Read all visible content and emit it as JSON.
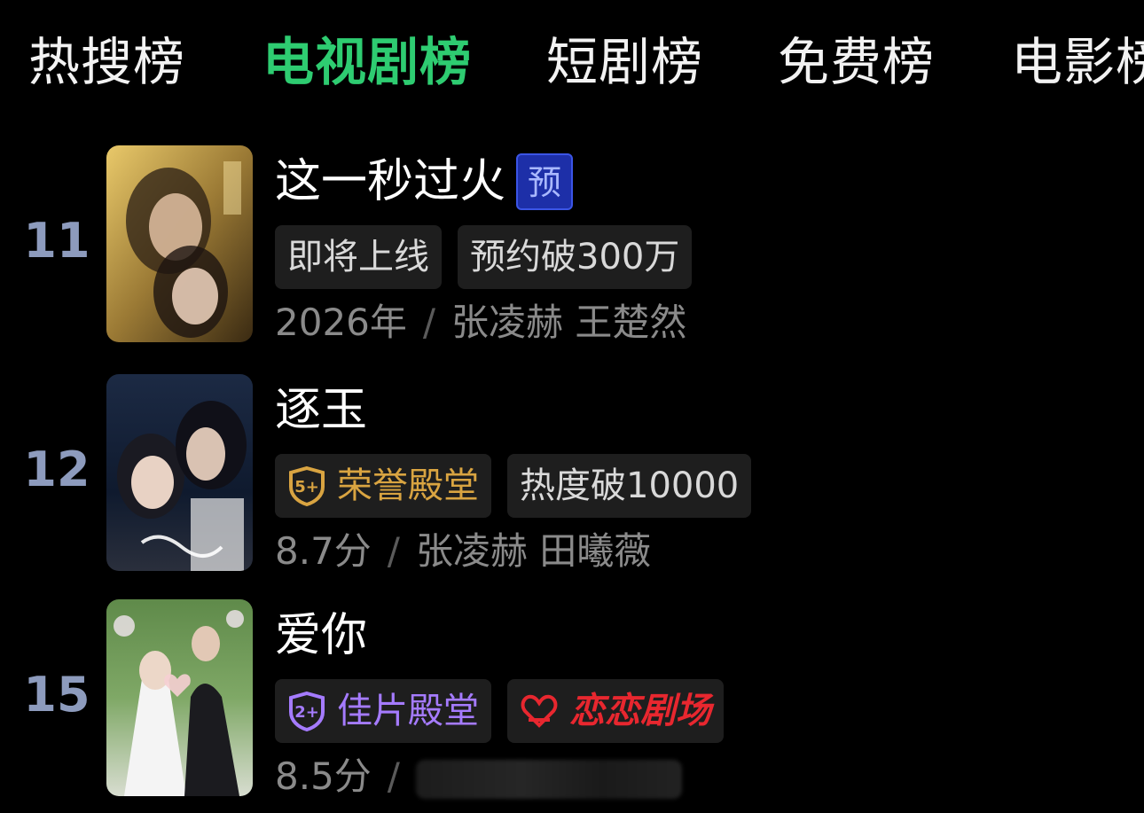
{
  "tabs": [
    {
      "label": "热搜榜",
      "active": false
    },
    {
      "label": "电视剧榜",
      "active": true
    },
    {
      "label": "短剧榜",
      "active": false
    },
    {
      "label": "免费榜",
      "active": false
    },
    {
      "label": "电影榜",
      "active": false
    }
  ],
  "colors": {
    "background": "#000000",
    "active_tab": "#2ecc71",
    "rank": "#8d9bbd",
    "tag_bg": "#1e1e1e",
    "gold": "#d9a441",
    "purple": "#a57bff",
    "red": "#e8272f",
    "pre_badge": "#1d2fa8"
  },
  "items": [
    {
      "rank": "11",
      "title": "这一秒过火",
      "badge": "预",
      "tags": [
        "即将上线",
        "预约破300万"
      ],
      "meta_primary": "2026年",
      "separator": "/",
      "cast": "张凌赫 王楚然"
    },
    {
      "rank": "12",
      "title": "逐玉",
      "tags": [
        {
          "icon": "shield-5-icon",
          "icon_text": "5+",
          "label": "荣誉殿堂"
        },
        {
          "label": "热度破10000"
        }
      ],
      "meta_primary": "8.7分",
      "separator": "/",
      "cast": "张凌赫 田曦薇"
    },
    {
      "rank": "15",
      "title": "爱你",
      "tags": [
        {
          "icon": "shield-2-icon",
          "icon_text": "2+",
          "label": "佳片殿堂"
        },
        {
          "icon": "heart-logo-icon",
          "label": "恋恋剧场"
        }
      ],
      "meta_primary": "8.5分",
      "separator": "/",
      "cast_blurred": true
    }
  ]
}
